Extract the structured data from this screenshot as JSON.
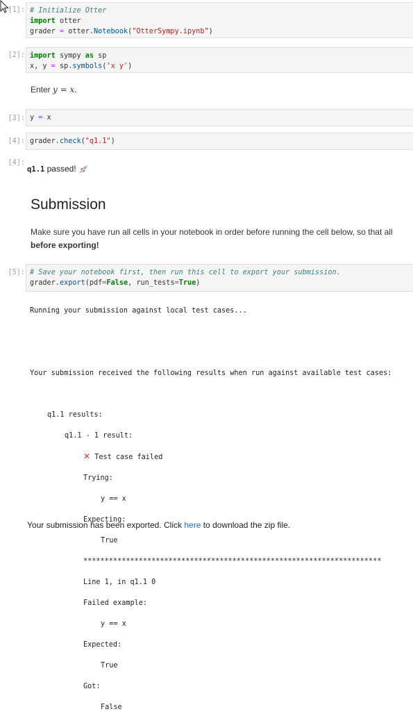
{
  "cells": [
    {
      "prompt": "[1]:",
      "lines": [
        "# Initialize Otter",
        "import otter",
        "grader = otter.Notebook(\"OtterSympy.ipynb\")"
      ]
    },
    {
      "prompt": "[2]:",
      "lines": [
        "import sympy as sp",
        "x, y = sp.symbols('x y')"
      ]
    },
    {
      "prompt": "[3]:",
      "lines": [
        "y = x"
      ]
    },
    {
      "prompt": "[4]:",
      "lines": [
        "grader.check(\"q1.1\")"
      ]
    },
    {
      "prompt": "[5]:",
      "lines": [
        "# Save your notebook first, then run this cell to export your submission.",
        "grader.export(pdf=False, run_tests=True)"
      ]
    }
  ],
  "markdown_enter": {
    "prefix": "Enter ",
    "math": "y = x."
  },
  "output4": {
    "prompt": "[4]:",
    "test_name": "q1.1",
    "passed_text": " passed!",
    "emoji": "rocket"
  },
  "submission": {
    "heading": "Submission",
    "line1": "Make sure you have run all cells in your notebook in order before running the cell below, so that all",
    "line2": "before exporting!"
  },
  "output5": {
    "running": "Running your submission against local test cases...",
    "received": "Your submission received the following results when run against available test cases:",
    "results_header": "q1.1 results:",
    "result_line": "q1.1 - 1 result:",
    "failed_label": "Test case failed",
    "trying": "Trying:",
    "trying_code": "y == x",
    "expecting": "Expecting:",
    "expecting_val": "True",
    "stars": "**********************************************************************",
    "line_info": "Line 1, in q1.1 0",
    "failed_example": "Failed example:",
    "failed_code": "y == x",
    "expected": "Expected:",
    "expected_val": "True",
    "got": "Got:",
    "got_val": "False"
  },
  "export_msg": {
    "before": "Your submission has been exported. Click ",
    "link": "here",
    "after": " to download the zip file."
  }
}
